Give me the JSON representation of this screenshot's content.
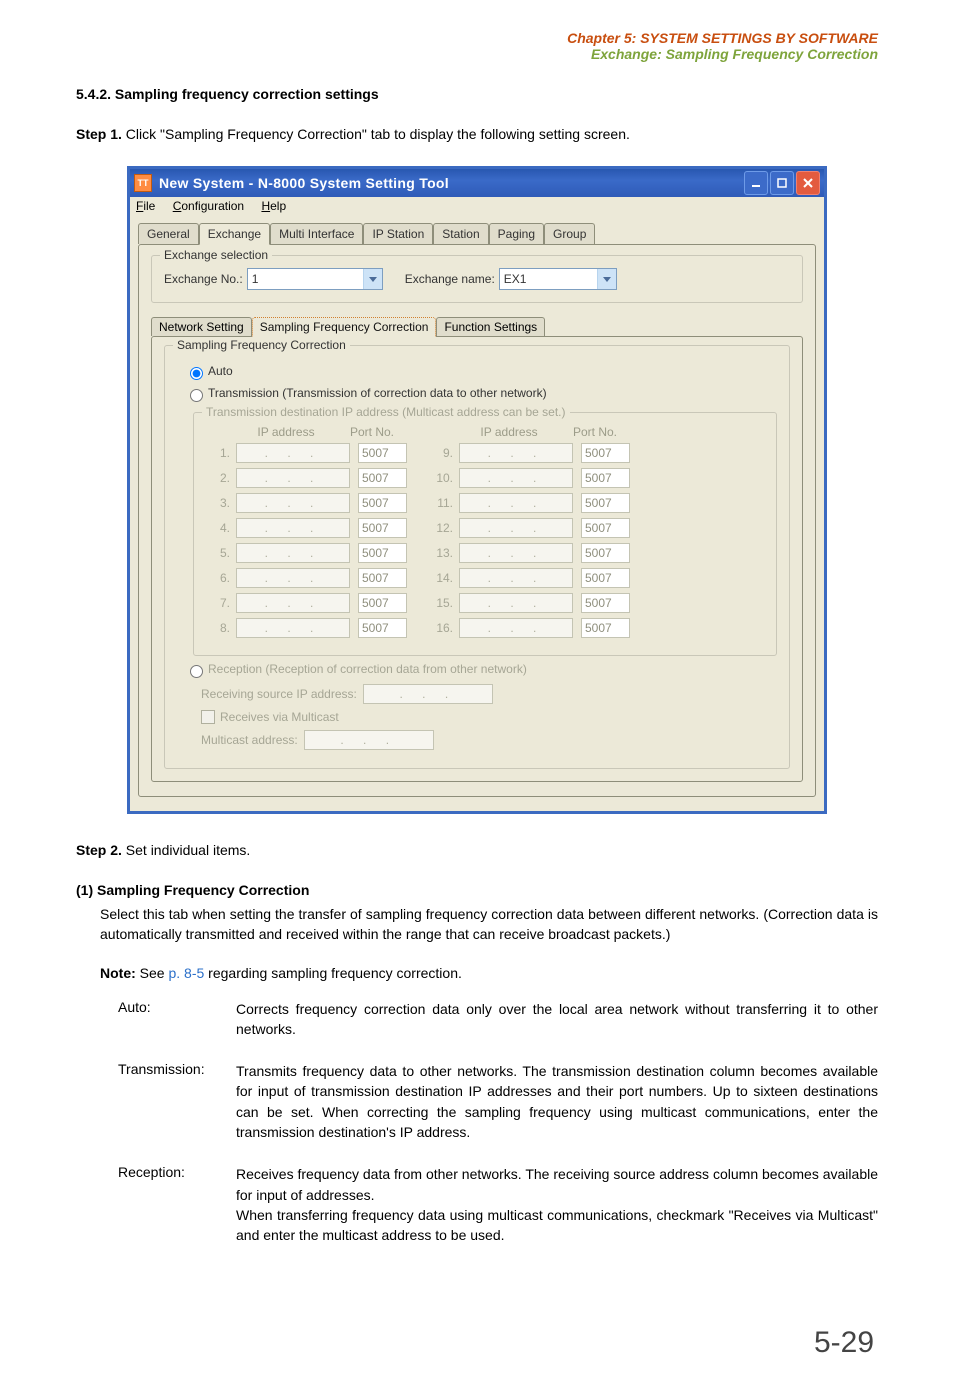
{
  "header": {
    "chapter": "Chapter 5:  SYSTEM SETTINGS BY SOFTWARE",
    "section": "Exchange: Sampling Frequency Correction"
  },
  "sec_title": "5.4.2. Sampling frequency correction settings",
  "step1": {
    "label": "Step 1.",
    "text": " Click \"Sampling Frequency Correction\" tab to display the following setting screen."
  },
  "win": {
    "title": "New System - N-8000 System Setting Tool",
    "menu": {
      "file": "File",
      "file_u": "F",
      "config": "Configuration",
      "config_u": "C",
      "help": "Help",
      "help_u": "H"
    },
    "tabs": {
      "general": "General",
      "exchange": "Exchange",
      "multi": "Multi Interface",
      "ip": "IP Station",
      "station": "Station",
      "paging": "Paging",
      "group": "Group"
    },
    "exch_sel": {
      "legend": "Exchange selection",
      "no_label": "Exchange No.:",
      "no_val": "1",
      "name_label": "Exchange name:",
      "name_val": "EX1"
    },
    "subtabs": {
      "net": "Network Setting",
      "sfc": "Sampling Frequency Correction",
      "fn": "Function Settings"
    },
    "sfc_grp": {
      "legend": "Sampling Frequency Correction",
      "auto": "Auto",
      "trans": "Transmission (Transmission of correction data to other network)"
    },
    "dest": {
      "legend": "Transmission destination IP address (Multicast address can be set.)",
      "col_ip": "IP address",
      "col_port": "Port No.",
      "rows_left": [
        {
          "n": "1.",
          "port": "5007"
        },
        {
          "n": "2.",
          "port": "5007"
        },
        {
          "n": "3.",
          "port": "5007"
        },
        {
          "n": "4.",
          "port": "5007"
        },
        {
          "n": "5.",
          "port": "5007"
        },
        {
          "n": "6.",
          "port": "5007"
        },
        {
          "n": "7.",
          "port": "5007"
        },
        {
          "n": "8.",
          "port": "5007"
        }
      ],
      "rows_right": [
        {
          "n": "9.",
          "port": "5007"
        },
        {
          "n": "10.",
          "port": "5007"
        },
        {
          "n": "11.",
          "port": "5007"
        },
        {
          "n": "12.",
          "port": "5007"
        },
        {
          "n": "13.",
          "port": "5007"
        },
        {
          "n": "14.",
          "port": "5007"
        },
        {
          "n": "15.",
          "port": "5007"
        },
        {
          "n": "16.",
          "port": "5007"
        }
      ],
      "ip_dots": ". . ."
    },
    "rx": {
      "label": "Reception (Reception of correction data from other network)",
      "src": "Receiving source IP address:",
      "via": "Receives via Multicast",
      "ma": "Multicast address:",
      "ip_dots": ". . ."
    }
  },
  "step2": {
    "label": "Step 2.",
    "text": " Set individual items."
  },
  "defn": {
    "title": "(1)  Sampling Frequency Correction",
    "body": "Select this tab when setting the transfer of sampling frequency correction data between different networks. (Correction data is automatically transmitted and received within the range that can receive broadcast packets.)",
    "note_b": "Note:",
    "note_t": " See ",
    "note_link": "p. 8-5",
    "note_after": " regarding sampling frequency correction.",
    "auto_l": "Auto:",
    "auto_t": "Corrects frequency correction data only over the local area network without transferring it to other networks.",
    "tx_l": "Transmission:",
    "tx_t": "Transmits frequency data to other networks. The transmission destination column becomes available for input of transmission destination IP addresses and their port numbers. Up to sixteen destinations can be set. When correcting the sampling frequency using multicast communications, enter the transmission destination's IP address.",
    "rx_l": "Reception:",
    "rx_t1": "Receives frequency data from other networks. The receiving source address column becomes available for input of addresses.",
    "rx_t2": "When transferring frequency data using multicast communications, checkmark \"Receives via Multicast\" and enter the multicast address to be used."
  },
  "pageno": "5-29"
}
